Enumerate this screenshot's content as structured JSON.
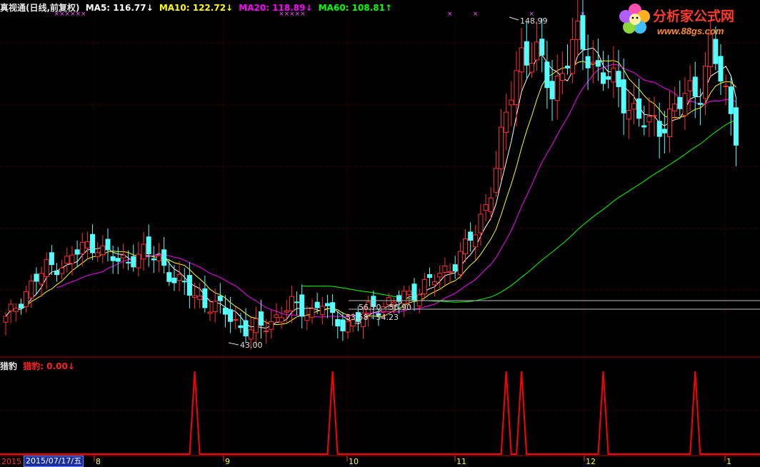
{
  "header": {
    "title": "真视通(日线,前复权)",
    "ma5_label": "MA5: 116.77↓",
    "ma10_label": "MA10: 122.72↓",
    "ma20_label": "MA20: 118.89↓",
    "ma60_label": "MA60: 108.81↑"
  },
  "indicator": {
    "name": "猎豹",
    "value_label": "猎豹: 0.00↓"
  },
  "annotations": {
    "high": "148.99",
    "low": "43.00",
    "level_a": "56.70 - 56.90",
    "level_b": "53.58 - 54.23"
  },
  "axis": {
    "year_start": "2015",
    "selected_date": "2015/07/17/五",
    "month_labels": [
      "8",
      "9",
      "10",
      "11",
      "12",
      "1"
    ]
  },
  "logo": {
    "name": "分析家公式网",
    "url": "www.88gs.com"
  },
  "colors": {
    "up": "#ff3030",
    "down": "#54ffff",
    "ma5": "#ffffff",
    "ma10": "#ffff00",
    "ma20": "#ff00ff",
    "ma60": "#00ff00",
    "indicator": "#ff0000",
    "grid": "#7a0000"
  },
  "chart_data": {
    "type": "candlestick",
    "price_range": [
      38,
      154
    ],
    "ma_values_last": {
      "MA5": 116.77,
      "MA10": 122.72,
      "MA20": 118.89,
      "MA60": 108.81
    },
    "indicator_signals_at_candle_index": [
      37,
      64,
      98,
      101,
      117,
      135
    ]
  }
}
